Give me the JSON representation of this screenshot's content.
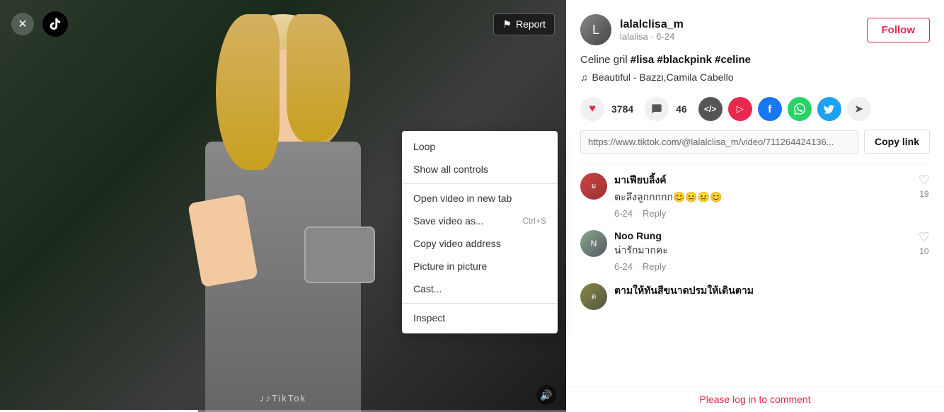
{
  "app": {
    "title": "TikTok"
  },
  "header": {
    "close_label": "✕",
    "report_label": "Report",
    "report_icon": "⚑"
  },
  "video": {
    "watermark": "♪♪TikTok",
    "progress_percent": 35
  },
  "context_menu": {
    "items": [
      {
        "id": "loop",
        "label": "Loop",
        "shortcut": ""
      },
      {
        "id": "show-controls",
        "label": "Show all controls",
        "shortcut": ""
      },
      {
        "id": "divider1",
        "type": "divider"
      },
      {
        "id": "open-new-tab",
        "label": "Open video in new tab",
        "shortcut": ""
      },
      {
        "id": "save-video",
        "label": "Save video as...",
        "shortcut": "Ctrl+S"
      },
      {
        "id": "copy-address",
        "label": "Copy video address",
        "shortcut": ""
      },
      {
        "id": "pip",
        "label": "Picture in picture",
        "shortcut": ""
      },
      {
        "id": "cast",
        "label": "Cast...",
        "shortcut": ""
      },
      {
        "id": "divider2",
        "type": "divider"
      },
      {
        "id": "inspect",
        "label": "Inspect",
        "shortcut": ""
      }
    ]
  },
  "right_panel": {
    "user": {
      "username": "lalalclisa_m",
      "sub_label": "lalalisa · 6-24",
      "avatar_letter": "L"
    },
    "follow_label": "Follow",
    "description": {
      "normal": "Celine gril ",
      "tags": "#lisa #blackpink #celine"
    },
    "music": {
      "icon": "♫",
      "label": "Beautiful - Bazzi,Camila Cabello"
    },
    "likes": {
      "count": "3784",
      "heart_icon": "♥"
    },
    "comments": {
      "count": "46"
    },
    "url": {
      "value": "https://www.tiktok.com/@lalalclisa_m/video/711264424136...",
      "copy_label": "Copy link"
    },
    "comments_list": [
      {
        "id": "c1",
        "user": "มาเฟียบลิ้งค์",
        "avatar_letter": "ม",
        "text": "ตะลึงลูกกกกก😊😐😐😊",
        "date": "6-24",
        "reply": "Reply",
        "likes": 19
      },
      {
        "id": "c2",
        "user": "Noo Rung",
        "avatar_letter": "N",
        "text": "น่ารักมากคะ",
        "date": "6-24",
        "reply": "Reply",
        "likes": 10
      },
      {
        "id": "c3",
        "user": "ตามให้ทันสีขนาดปรมให้เดินตาม",
        "avatar_letter": "ต",
        "text": "",
        "date": "",
        "reply": "",
        "likes": 0
      }
    ],
    "login_prompt": "Please log in to comment"
  }
}
